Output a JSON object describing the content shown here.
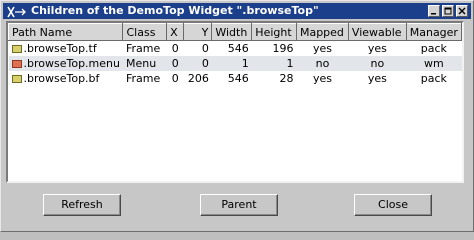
{
  "window": {
    "title": "Children of the DemoTop Widget \".browseTop\""
  },
  "table": {
    "columns": [
      "Path Name",
      "Class",
      "X",
      "Y",
      "Width",
      "Height",
      "Mapped",
      "Viewable",
      "Manager"
    ],
    "rows": [
      {
        "icon": "frame-widget-icon",
        "path": ".browseTop.tf",
        "class": "Frame",
        "x": "0",
        "y": "0",
        "width": "546",
        "height": "196",
        "mapped": "yes",
        "viewable": "yes",
        "manager": "pack"
      },
      {
        "icon": "menu-widget-icon",
        "path": ".browseTop.menu",
        "class": "Menu",
        "x": "0",
        "y": "0",
        "width": "1",
        "height": "1",
        "mapped": "no",
        "viewable": "no",
        "manager": "wm"
      },
      {
        "icon": "frame-widget-icon",
        "path": ".browseTop.bf",
        "class": "Frame",
        "x": "0",
        "y": "206",
        "width": "546",
        "height": "28",
        "mapped": "yes",
        "viewable": "yes",
        "manager": "pack"
      }
    ]
  },
  "buttons": {
    "refresh": "Refresh",
    "parent": "Parent",
    "close": "Close"
  },
  "colors": {
    "titlebar": "#1b3f8b",
    "selected_row": "#e2e6ea",
    "frame_icon": "#d9d06a",
    "menu_icon": "#e07050"
  }
}
